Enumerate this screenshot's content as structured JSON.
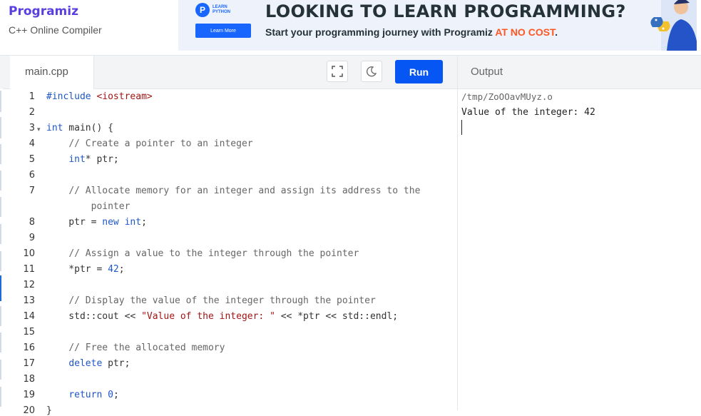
{
  "header": {
    "logo_text": "Programiz",
    "subtitle": "C++ Online Compiler"
  },
  "ad": {
    "brand_small": "LEARN PYTHON",
    "brand_line1": "LEARN",
    "brand_line2": "PYTHON",
    "learn_more": "Learn More",
    "headline": "LOOKING TO LEARN PROGRAMMING?",
    "sub_prefix": "Start your programming journey with Programiz ",
    "sub_highlight": "AT NO COST",
    "sub_suffix": "."
  },
  "editor": {
    "tab_label": "main.cpp",
    "run_label": "Run",
    "fullscreen_icon": "fullscreen-icon",
    "theme_icon": "moon-icon",
    "line_numbers": [
      "1",
      "2",
      "3",
      "4",
      "5",
      "6",
      "7",
      "",
      "8",
      "9",
      "10",
      "11",
      "12",
      "13",
      "14",
      "15",
      "16",
      "17",
      "18",
      "19",
      "20"
    ]
  },
  "output": {
    "title": "Output",
    "lines": [
      "/tmp/ZoOOavMUyz.o",
      "Value of the integer: 42"
    ]
  }
}
